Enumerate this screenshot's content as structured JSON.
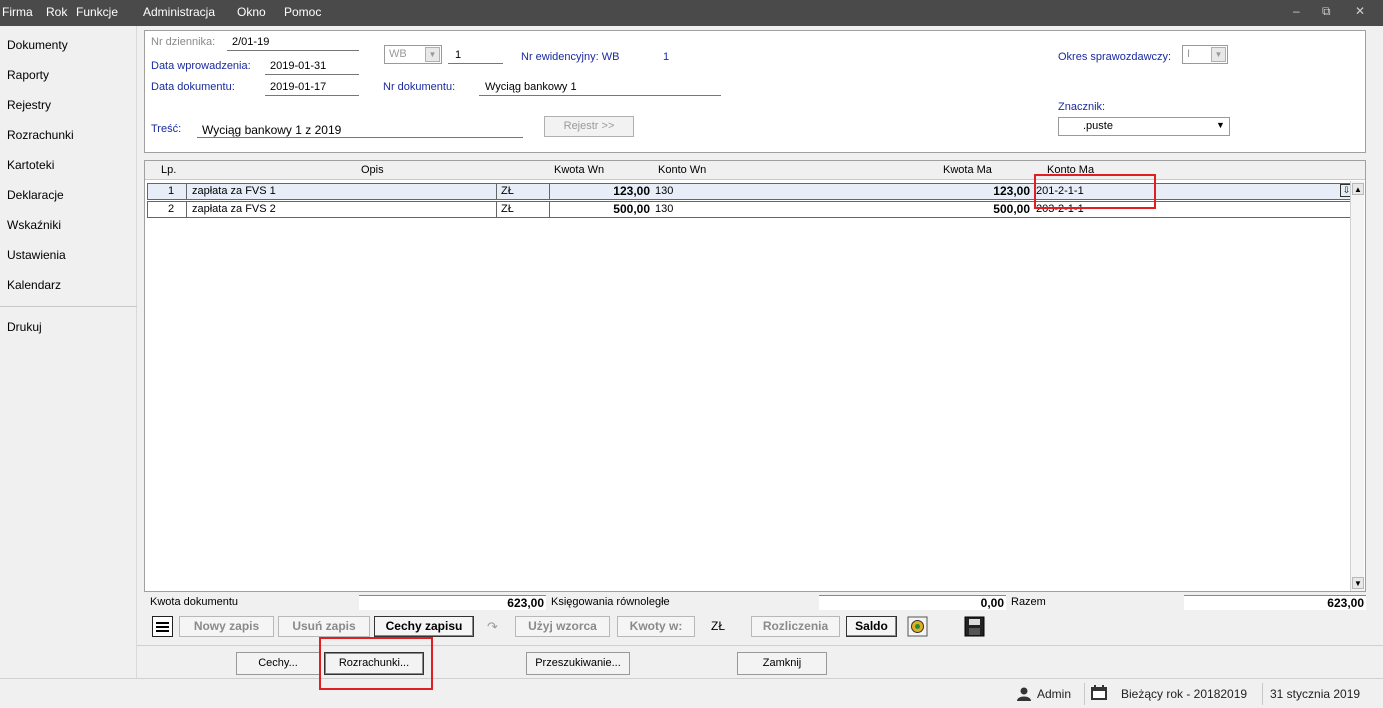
{
  "menu": [
    "Firma",
    "Rok",
    "Funkcje",
    "Administracja",
    "Okno",
    "Pomoc"
  ],
  "sidebar": {
    "items": [
      "Dokumenty",
      "Raporty",
      "Rejestry",
      "Rozrachunki",
      "Kartoteki",
      "Deklaracje",
      "Wskaźniki",
      "Ustawienia",
      "Kalendarz"
    ],
    "print": "Drukuj"
  },
  "header": {
    "nr_dziennika_label": "Nr dziennika:",
    "nr_dziennika": "2/01-19",
    "data_wprowadzenia_label": "Data wprowadzenia:",
    "data_wprowadzenia": "2019-01-31",
    "data_dokumentu_label": "Data dokumentu:",
    "data_dokumentu": "2019-01-17",
    "typ": "WB",
    "nr_typ": "1",
    "nr_ewidencyjny_label": "Nr ewidencyjny: WB",
    "nr_ewidencyjny": "1",
    "nr_dokumentu_label": "Nr dokumentu:",
    "nr_dokumentu": "Wyciąg bankowy 1",
    "tresc_label": "Treść:",
    "tresc": "Wyciąg bankowy 1 z 2019",
    "rejestr_button": "Rejestr >>",
    "okres_label": "Okres sprawozdawczy:",
    "okres": "I",
    "znacznik_label": "Znacznik:",
    "znacznik": ".puste"
  },
  "grid": {
    "columns": [
      "Lp.",
      "Opis",
      "Kwota Wn",
      "Konto Wn",
      "Kwota Ma",
      "Konto Ma"
    ],
    "rows": [
      {
        "lp": "1",
        "opis": "zapłata za FVS 1",
        "waluta": "ZŁ",
        "kwota_wn": "123,00",
        "konto_wn": "130",
        "kwota_ma": "123,00",
        "konto_ma": "201-2-1-1"
      },
      {
        "lp": "2",
        "opis": "zapłata za FVS 2",
        "waluta": "ZŁ",
        "kwota_wn": "500,00",
        "konto_wn": "130",
        "kwota_ma": "500,00",
        "konto_ma": "203-2-1-1"
      }
    ]
  },
  "totals": {
    "kwota_dokumentu_label": "Kwota dokumentu",
    "kwota_dokumentu": "623,00",
    "ksiegowania_label": "Księgowania równoległe",
    "ksiegowania": "0,00",
    "razem_label": "Razem",
    "razem": "623,00"
  },
  "toolbar": {
    "nowy_zapis": "Nowy zapis",
    "usun_zapis": "Usuń zapis",
    "cechy_zapisu": "Cechy zapisu",
    "uzyj_wzorca": "Użyj wzorca",
    "kwoty_w": "Kwoty w:",
    "waluta": "ZŁ",
    "rozliczenia": "Rozliczenia",
    "saldo": "Saldo"
  },
  "bottom_buttons": {
    "cechy": "Cechy...",
    "rozrachunki": "Rozrachunki...",
    "przeszukiwanie": "Przeszukiwanie...",
    "zamknij": "Zamknij"
  },
  "status": {
    "user": "Admin",
    "year": "Bieżący rok - 20182019",
    "date": "31 stycznia 2019"
  },
  "colors": {
    "menubar": "#4a4a4a",
    "label_blue": "#1a2aa0",
    "highlight_red": "#e02020"
  }
}
